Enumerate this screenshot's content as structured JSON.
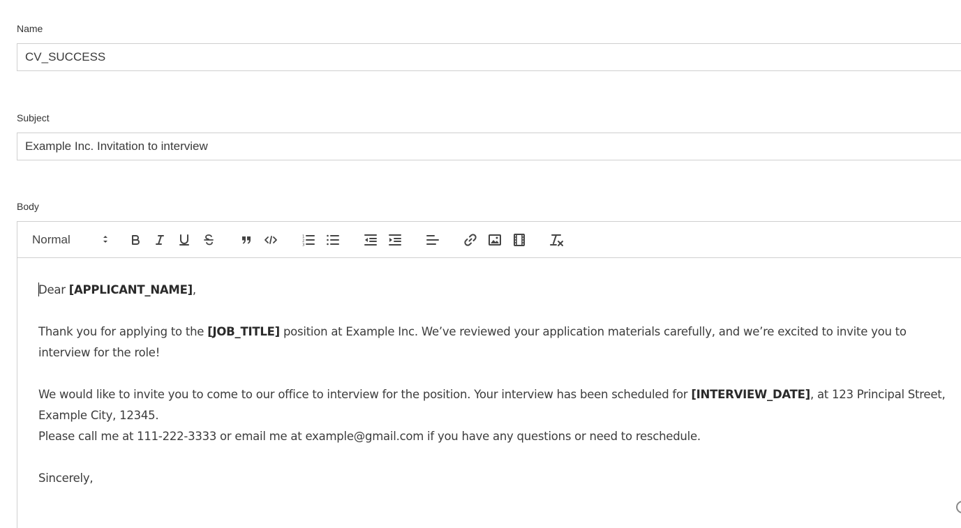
{
  "form": {
    "name": {
      "label": "Name",
      "value": "CV_SUCCESS"
    },
    "subject": {
      "label": "Subject",
      "value": "Example Inc. Invitation to interview"
    },
    "body": {
      "label": "Body"
    }
  },
  "toolbar": {
    "format_select": "Normal",
    "buttons": [
      "bold-icon",
      "italic-icon",
      "underline-icon",
      "strikethrough-icon",
      "blockquote-icon",
      "code-block-icon",
      "ordered-list-icon",
      "bullet-list-icon",
      "outdent-icon",
      "indent-icon",
      "align-left-icon",
      "link-icon",
      "image-icon",
      "video-icon",
      "clear-format-icon"
    ]
  },
  "email": {
    "greeting": {
      "pre": "Dear ",
      "placeholder": "[APPLICANT_NAME]",
      "post": ","
    },
    "paragraph1": {
      "pre": "Thank you for applying to the ",
      "placeholder": "[JOB_TITLE]",
      "post": " position at Example Inc. We’ve reviewed your application materials carefully, and we’re excited to invite you to interview for the role!"
    },
    "paragraph2": {
      "pre": "We would like to invite you to come to our office to interview for the position. Your interview has been scheduled for ",
      "placeholder": "[INTERVIEW_DATE]",
      "post": ", at 123 Principal Street, Example City, 12345."
    },
    "paragraph3": "Please call me at 111-222-3333 or email me at example@gmail.com if you have any questions or need to reschedule.",
    "closing": "Sincerely,"
  }
}
